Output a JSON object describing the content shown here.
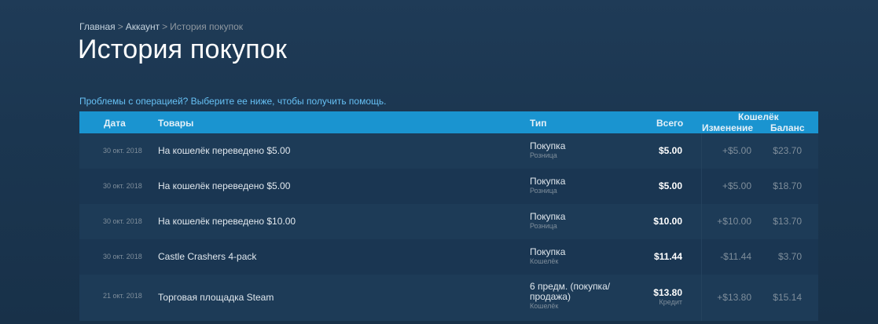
{
  "breadcrumb": {
    "home": "Главная",
    "sep1": ">",
    "account": "Аккаунт",
    "sep2": ">",
    "current": "История покупок"
  },
  "title": "История покупок",
  "help_link": "Проблемы с операцией? Выберите ее ниже, чтобы получить помощь.",
  "table": {
    "headers": {
      "date": "Дата",
      "items": "Товары",
      "type": "Тип",
      "total": "Всего",
      "wallet": "Кошелёк",
      "change": "Изменение",
      "balance": "Баланс"
    },
    "rows": [
      {
        "date": "30 окт. 2018",
        "item": "На кошелёк переведено $5.00",
        "type": "Покупка",
        "type_sub": "Розница",
        "total": "$5.00",
        "total_sub": "",
        "change": "+$5.00",
        "balance": "$23.70"
      },
      {
        "date": "30 окт. 2018",
        "item": "На кошелёк переведено $5.00",
        "type": "Покупка",
        "type_sub": "Розница",
        "total": "$5.00",
        "total_sub": "",
        "change": "+$5.00",
        "balance": "$18.70"
      },
      {
        "date": "30 окт. 2018",
        "item": "На кошелёк переведено $10.00",
        "type": "Покупка",
        "type_sub": "Розница",
        "total": "$10.00",
        "total_sub": "",
        "change": "+$10.00",
        "balance": "$13.70"
      },
      {
        "date": "30 окт. 2018",
        "item": "Castle Crashers 4-pack",
        "type": "Покупка",
        "type_sub": "Кошелёк",
        "total": "$11.44",
        "total_sub": "",
        "change": "-$11.44",
        "balance": "$3.70"
      },
      {
        "date": "21 окт. 2018",
        "item": "Торговая площадка Steam",
        "type": "6 предм. (покупка/",
        "type2": "продажа)",
        "type_sub": "Кошелёк",
        "total": "$13.80",
        "total_sub": "Кредит",
        "change": "+$13.80",
        "balance": "$15.14"
      }
    ]
  },
  "colors": {
    "header_bg": "#1a94d0",
    "link": "#66c0f4"
  }
}
